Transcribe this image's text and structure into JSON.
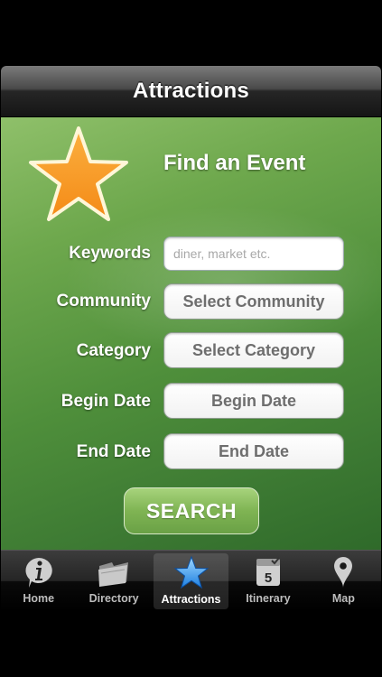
{
  "navbar": {
    "title": "Attractions"
  },
  "form": {
    "heading": "Find an Event",
    "keywords": {
      "label": "Keywords",
      "placeholder": "diner, market etc."
    },
    "community": {
      "label": "Community",
      "button": "Select Community"
    },
    "category": {
      "label": "Category",
      "button": "Select Category"
    },
    "begin_date": {
      "label": "Begin Date",
      "button": "Begin Date"
    },
    "end_date": {
      "label": "End Date",
      "button": "End Date"
    },
    "search_label": "SEARCH"
  },
  "tabs": [
    {
      "label": "Home",
      "icon": "info-icon"
    },
    {
      "label": "Directory",
      "icon": "folder-icon"
    },
    {
      "label": "Attractions",
      "icon": "star-icon",
      "active": true
    },
    {
      "label": "Itinerary",
      "icon": "calendar-icon",
      "day": "5"
    },
    {
      "label": "Map",
      "icon": "map-pin-icon"
    }
  ],
  "colors": {
    "accent_star": "#f7941d",
    "background_green": "#5a9a42",
    "button_green": "#7fb453"
  }
}
